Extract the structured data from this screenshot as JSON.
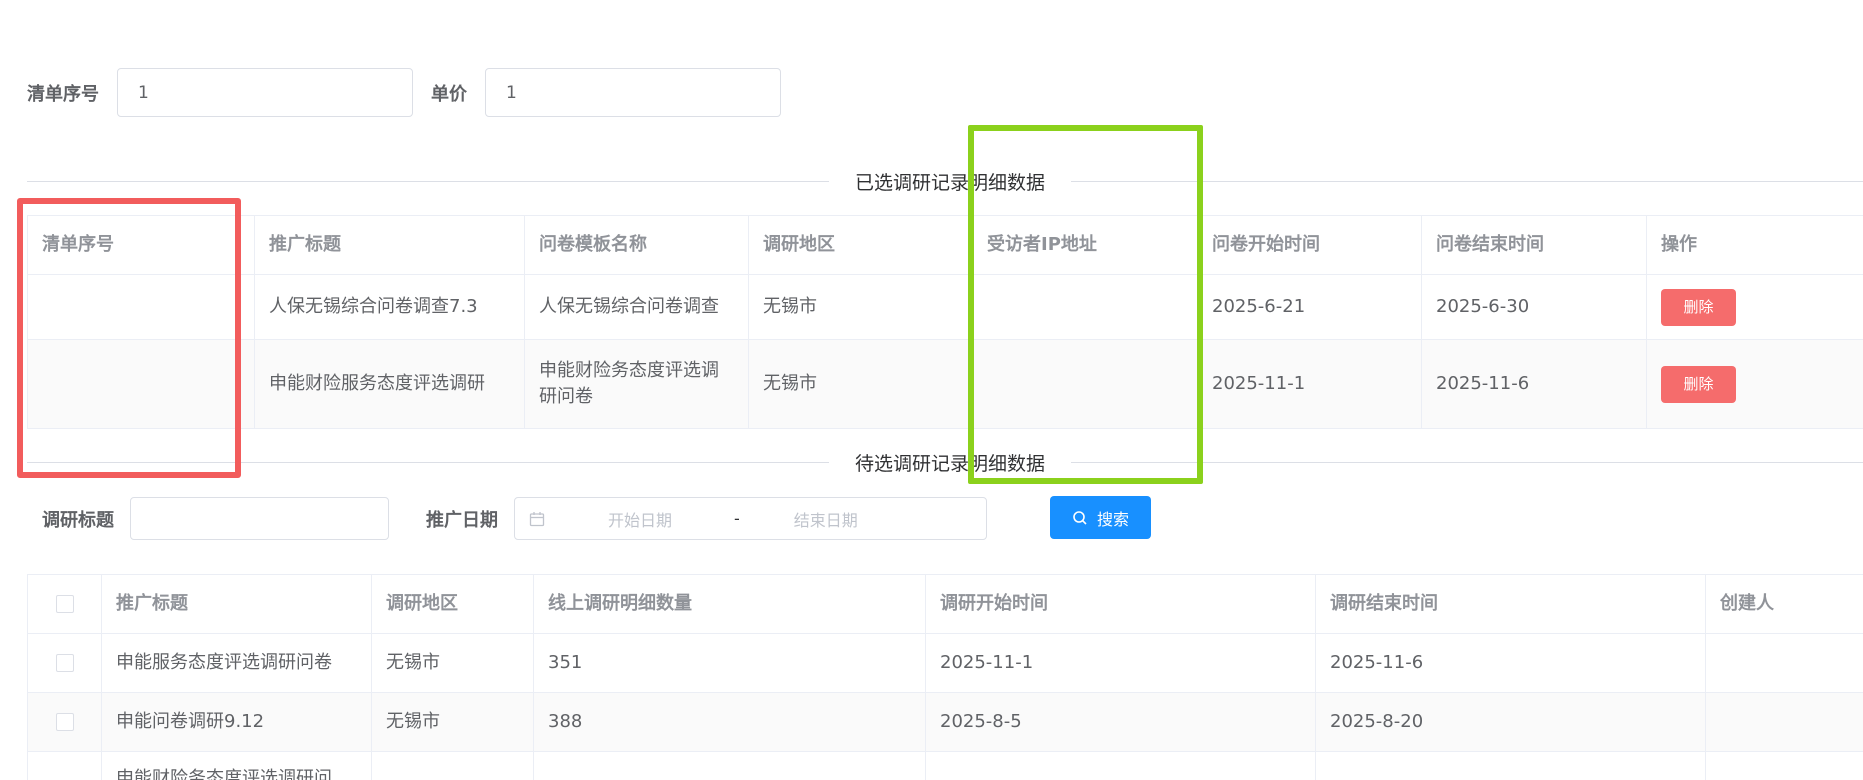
{
  "form": {
    "order_label": "清单序号",
    "order_value": "1",
    "price_label": "单价",
    "price_value": "1"
  },
  "selected_section": {
    "title": "已选调研记录明细数据",
    "columns": [
      "清单序号",
      "推广标题",
      "问卷模板名称",
      "调研地区",
      "受访者IP地址",
      "问卷开始时间",
      "问卷结束时间",
      "操作"
    ],
    "rows": [
      {
        "order": "",
        "title": "人保无锡综合问卷调查7.3",
        "template": "人保无锡综合问卷调查",
        "region": "无锡市",
        "ip": "",
        "start": "2025-6-21",
        "end": "2025-6-30",
        "action": "删除"
      },
      {
        "order": "",
        "title": "申能财险服务态度评选调研",
        "template": "申能财险务态度评选调研问卷",
        "region": "无锡市",
        "ip": "",
        "start": "2025-11-1",
        "end": "2025-11-6",
        "action": "删除"
      }
    ]
  },
  "pending_section": {
    "title": "待选调研记录明细数据",
    "search_title_label": "调研标题",
    "search_title_value": "",
    "promo_date_label": "推广日期",
    "start_date_placeholder": "开始日期",
    "date_separator": "-",
    "end_date_placeholder": "结束日期",
    "search_button": "搜索",
    "columns": [
      "推广标题",
      "调研地区",
      "线上调研明细数量",
      "调研开始时间",
      "调研结束时间",
      "创建人"
    ],
    "rows": [
      {
        "title": "申能服务态度评选调研问卷",
        "region": "无锡市",
        "count": "351",
        "start": "2025-11-1",
        "end": "2025-11-6",
        "creator": ""
      },
      {
        "title": "申能问卷调研9.12",
        "region": "无锡市",
        "count": "388",
        "start": "2025-8-5",
        "end": "2025-8-20",
        "creator": ""
      },
      {
        "title": "申能财险务态度评选调研问",
        "region": "",
        "count": "",
        "start": "",
        "end": "",
        "creator": ""
      }
    ]
  },
  "colors": {
    "danger": "#f56c6c",
    "primary": "#1890ff",
    "highlight_red": "#f25c5c",
    "highlight_green": "#8bd11c"
  }
}
